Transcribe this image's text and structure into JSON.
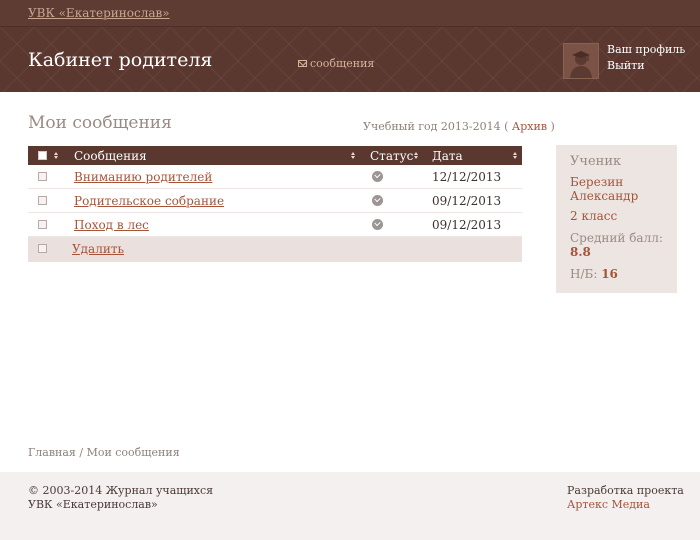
{
  "topbar": {
    "brand": "УВК «Екатеринослав»"
  },
  "header": {
    "title": "Кабинет родителя",
    "messages_link": "сообщения",
    "profile_link": "Ваш профиль",
    "logout_link": "Выйти"
  },
  "main": {
    "page_title": "Мои сообщения",
    "year_prefix": "Учебный год 2013-2014 (",
    "archive_link": "Архив",
    "year_suffix": ")"
  },
  "table": {
    "columns": {
      "subject": "Сообщения",
      "status": "Статус",
      "date": "Дата"
    },
    "rows": [
      {
        "subject": "Вниманию родителей",
        "status_icon": "check-icon",
        "date": "12/12/2013"
      },
      {
        "subject": "Родительское собрание",
        "status_icon": "check-icon",
        "date": "09/12/2013"
      },
      {
        "subject": "Поход в лес",
        "status_icon": "check-icon",
        "date": "09/12/2013"
      }
    ],
    "delete_label": "Удалить"
  },
  "sidebar": {
    "heading": "Ученик",
    "name_line1": "Березин",
    "name_line2": "Александр",
    "class": "2 класс",
    "avg_label_line1": "Средний",
    "avg_label_line2": "балл:",
    "avg_value": "8.8",
    "nb_label": "Н/Б:",
    "nb_value": "16"
  },
  "breadcrumb": {
    "home": "Главная",
    "separator": " / ",
    "current": "Мои сообщения"
  },
  "footer": {
    "copyright_line1": "© 2003-2014 Журнал учащихся",
    "copyright_line2": "УВК «Екатеринослав»",
    "dev_label": "Разработка проекта",
    "dev_link": "Артекс Медиа"
  },
  "colors": {
    "header_bg": "#5a3830",
    "accent_link": "#a5543a",
    "sidebar_bg": "#ede5e2"
  }
}
